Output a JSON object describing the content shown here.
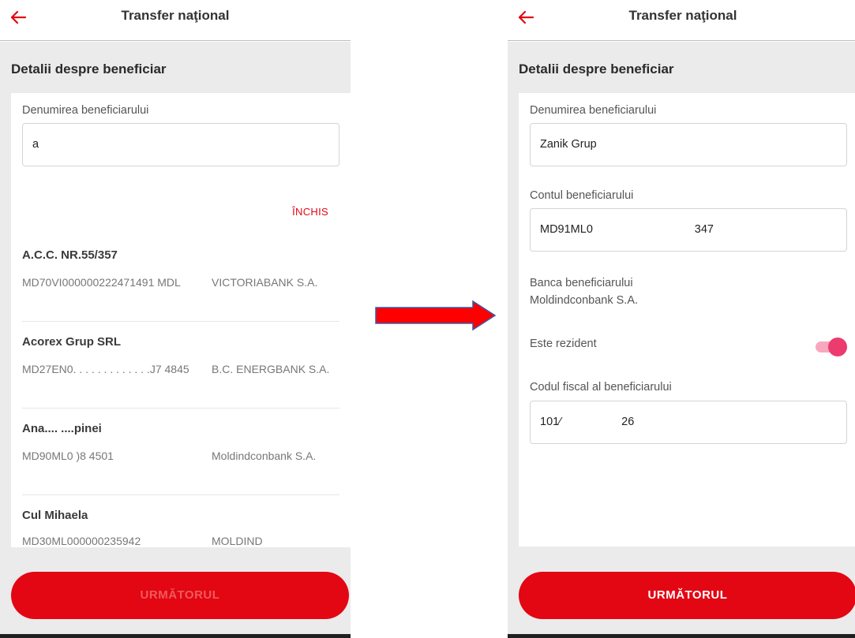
{
  "colors": {
    "accent": "#e30613",
    "toggle_on": "#ec3b6e",
    "background": "#ebebeb"
  },
  "left": {
    "header": {
      "title": "Transfer naţional",
      "back_icon": "arrow-left-icon"
    },
    "section_title": "Detalii despre beneficiar",
    "name_field": {
      "label": "Denumirea beneficiarului",
      "value": "a"
    },
    "close_label": "ÎNCHIS",
    "suggestions": [
      {
        "name": "A.C.C. NR.55/357",
        "account": "MD70VI000000222471491 MDL",
        "bank": "VICTORIABANK S.A."
      },
      {
        "name": "Acorex Grup SRL",
        "account": "MD27EN0. . . . . . . . . . . . .J7 4845",
        "bank": "B.C. ENERGBANK S.A."
      },
      {
        "name": "Ana.... ....pinei",
        "account": "MD90ML0                              )8 4501",
        "bank": "Moldindconbank S.A."
      },
      {
        "name": "Cul     Mihaela",
        "account": "MD30ML000000235942",
        "bank": "MOLDIND"
      }
    ],
    "next_button": "URMĂTORUL"
  },
  "right": {
    "header": {
      "title": "Transfer naţional",
      "back_icon": "arrow-left-icon"
    },
    "section_title": "Detalii despre beneficiar",
    "name_field": {
      "label": "Denumirea beneficiarului",
      "value": "Zanik Grup"
    },
    "account_field": {
      "label": "Contul beneficiarului",
      "value": "MD91ML0                                347"
    },
    "bank": {
      "label": "Banca beneficiarului",
      "value": "Moldindconbank S.A."
    },
    "resident": {
      "label": "Este rezident",
      "on": true
    },
    "fiscal_field": {
      "label": "Codul fiscal al beneficiarului",
      "value": "101⁄                   26"
    },
    "next_button": "URMĂTORUL"
  },
  "arrow": {
    "color": "#ff0000",
    "icon": "arrow-right-icon"
  }
}
